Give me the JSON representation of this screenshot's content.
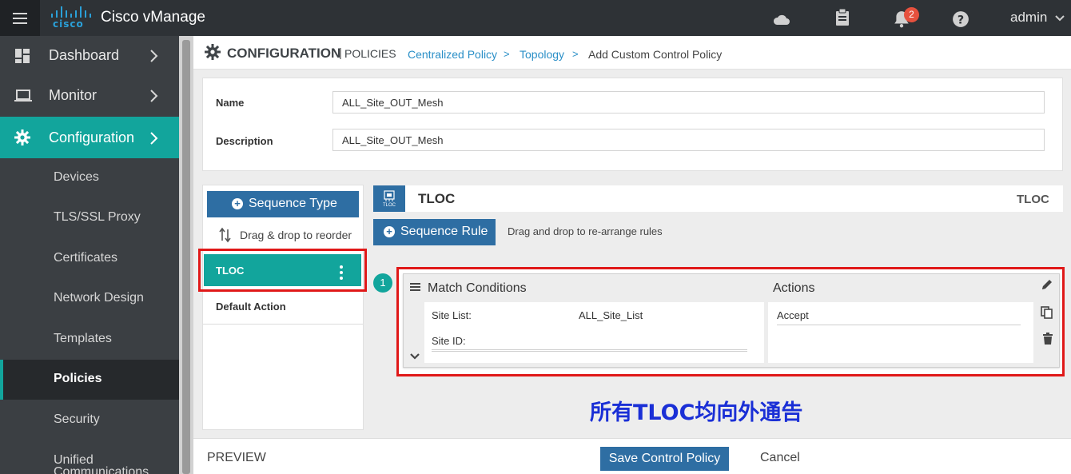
{
  "app": {
    "brand": "cisco",
    "title": "Cisco vManage"
  },
  "topbar": {
    "notification_count": "2",
    "user": "admin"
  },
  "sidebar": {
    "items": [
      {
        "label": "Dashboard"
      },
      {
        "label": "Monitor"
      },
      {
        "label": "Configuration"
      }
    ],
    "subitems": [
      {
        "label": "Devices"
      },
      {
        "label": "TLS/SSL Proxy"
      },
      {
        "label": "Certificates"
      },
      {
        "label": "Network Design"
      },
      {
        "label": "Templates"
      },
      {
        "label": "Policies"
      },
      {
        "label": "Security"
      },
      {
        "label": "Unified Communications"
      }
    ],
    "selected": "Policies"
  },
  "breadcrumb": {
    "section": "CONFIGURATION",
    "page": "POLICIES",
    "links": [
      "Centralized Policy",
      "Topology"
    ],
    "separator": ">",
    "current": "Add Custom Control Policy"
  },
  "form": {
    "name_label": "Name",
    "name_value": "ALL_Site_OUT_Mesh",
    "description_label": "Description",
    "description_value": "ALL_Site_OUT_Mesh"
  },
  "sequence_panel": {
    "add_button": "Sequence Type",
    "reorder_hint": "Drag & drop to reorder",
    "items": [
      {
        "label": "TLOC"
      }
    ],
    "default_action": "Default Action"
  },
  "rule_panel": {
    "badge_tag": "TLOC",
    "title": "TLOC",
    "title_right": "TLOC",
    "add_rule_button": "Sequence Rule",
    "rule_hint": "Drag and drop to re-arrange rules",
    "rules": [
      {
        "number": "1",
        "match_header": "Match Conditions",
        "actions_header": "Actions",
        "conditions": [
          {
            "label": "Site List:",
            "value": "ALL_Site_List"
          },
          {
            "label": "Site ID:",
            "value": ""
          }
        ],
        "actions": [
          "Accept"
        ]
      }
    ]
  },
  "annotation": "所有TLOC均向外通告",
  "footer": {
    "preview": "PREVIEW",
    "save": "Save Control Policy",
    "cancel": "Cancel"
  },
  "colors": {
    "accent_teal": "#12a59c",
    "primary_blue": "#2e6ea3",
    "highlight_red": "#e01818",
    "annotation_blue": "#1a2fd6"
  }
}
